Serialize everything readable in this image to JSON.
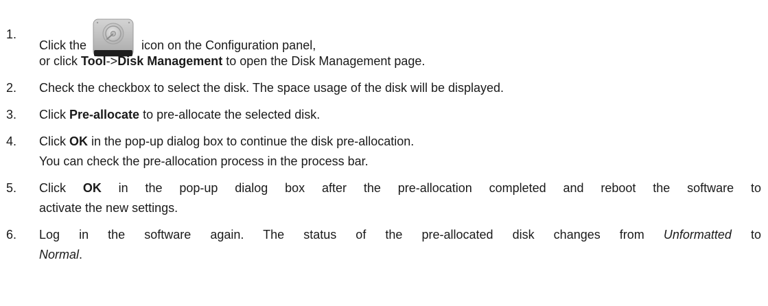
{
  "steps": [
    {
      "number": "1.",
      "line1_before_icon": "Click the",
      "icon": "disk-icon",
      "line1_after_icon": "icon on the Configuration panel,",
      "line2_a": "or click ",
      "line2_b_bold": "Tool",
      "line2_c": "->",
      "line2_d_bold": "Disk Management",
      "line2_e": " to open the Disk Management page."
    },
    {
      "number": "2.",
      "text": "Check the checkbox to select the disk. The space usage of the disk will be displayed."
    },
    {
      "number": "3.",
      "a": "Click ",
      "b_bold": "Pre-allocate",
      "c": " to pre-allocate the selected disk."
    },
    {
      "number": "4.",
      "a": "Click ",
      "b_bold": "OK",
      "c": " in the pop-up dialog box to continue the disk pre-allocation.",
      "line2": "You can check the pre-allocation process in the process bar."
    },
    {
      "number": "5.",
      "a": "Click ",
      "b_bold": "OK",
      "c": " in the pop-up dialog box after the pre-allocation completed and reboot the software to",
      "line2": "activate the new settings."
    },
    {
      "number": "6.",
      "a": "Log in the software again. The status of the pre-allocated disk changes from ",
      "b_italic": "Unformatted",
      "c": " to",
      "line2_italic": "Normal",
      "line2_end": "."
    }
  ]
}
